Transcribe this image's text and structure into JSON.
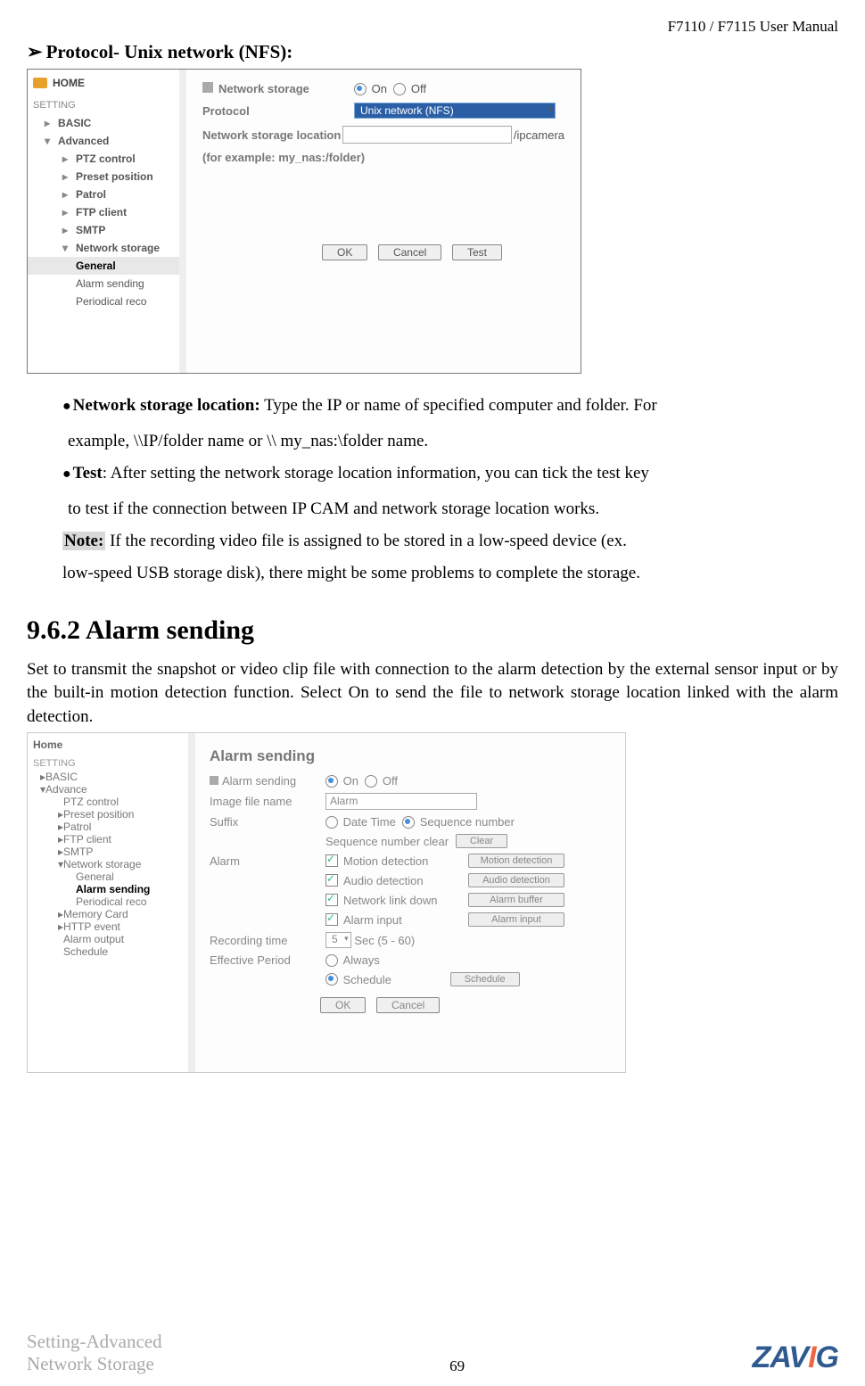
{
  "header_right": "F7110 / F7115 User Manual",
  "section1_title": "Protocol- Unix network (NFS):",
  "arrow_char": "➢",
  "screenshot1": {
    "sidebar": {
      "home": "HOME",
      "setting_label": "SETTING",
      "basic": "BASIC",
      "advanced": "Advanced",
      "items": [
        "PTZ control",
        "Preset position",
        "Patrol",
        "FTP client",
        "SMTP",
        "Network storage"
      ],
      "sub_general": "General",
      "sub_alarm": "Alarm sending",
      "sub_periodical": "Periodical reco"
    },
    "main": {
      "ns_label": "Network storage",
      "on": "On",
      "off": "Off",
      "protocol_label": "Protocol",
      "protocol_value": "Unix network (NFS)",
      "location_label": "Network storage location",
      "location_suffix": "/ipcamera",
      "example": "(for example: my_nas:/folder)",
      "ok": "OK",
      "cancel": "Cancel",
      "test": "Test"
    }
  },
  "body_text": {
    "bullet1_label": "Network storage location:",
    "bullet1_tail_a": " Type the IP or name of specified computer and folder. For",
    "bullet1_tail_b": "example, \\\\IP/folder name or \\\\ my_nas:\\folder name.",
    "bullet2_label": "Test",
    "bullet2_tail_a": ": After setting the network storage location information, you can tick the test key",
    "bullet2_tail_b": "to test if the connection between IP CAM and network storage location works.",
    "note_label": "Note:",
    "note_tail_a": " If the recording video file is assigned to be stored in a low-speed device (ex.",
    "note_tail_b": "low-speed USB storage disk), there might be some problems to complete the storage."
  },
  "section2_heading": "9.6.2 Alarm sending",
  "section2_para": "Set to transmit the snapshot or video clip file with connection to the alarm detection by the external sensor input or by the built-in motion detection function. Select On to send the file to network storage location linked with the alarm detection.",
  "screenshot2": {
    "sidebar": {
      "home": "Home",
      "setting_label": "SETTING",
      "basic": "BASIC",
      "advance": "Advance",
      "items": [
        "PTZ control",
        "Preset position",
        "Patrol",
        "FTP client",
        "SMTP",
        "Network storage"
      ],
      "sub_general": "General",
      "sub_alarm": "Alarm sending",
      "sub_periodical": "Periodical reco",
      "memory": "Memory Card",
      "http_event": "HTTP event",
      "alarm_output": "Alarm output",
      "schedule": "Schedule"
    },
    "main": {
      "title": "Alarm sending",
      "alarm_sending_label": "Alarm sending",
      "on": "On",
      "off": "Off",
      "image_file_label": "Image file name",
      "image_file_value": "Alarm",
      "suffix_label": "Suffix",
      "suffix_date": "Date Time",
      "suffix_seq": "Sequence number",
      "seq_clear_label": "Sequence number clear",
      "clear_btn": "Clear",
      "alarm_label": "Alarm",
      "alarm_chk1": "Motion detection",
      "alarm_btn1": "Motion detection",
      "alarm_chk2": "Audio detection",
      "alarm_btn2": "Audio detection",
      "alarm_chk3": "Network link down",
      "alarm_btn3": "Alarm buffer",
      "alarm_chk4": "Alarm input",
      "alarm_btn4": "Alarm input",
      "rec_time_label": "Recording time",
      "rec_time_value": "5",
      "rec_time_unit": "Sec (5 - 60)",
      "eff_period_label": "Effective Period",
      "eff_always": "Always",
      "eff_schedule": "Schedule",
      "schedule_btn": "Schedule",
      "ok": "OK",
      "cancel": "Cancel"
    }
  },
  "footer": {
    "left_line1": "Setting-Advanced",
    "left_line2": "Network Storage",
    "page_number": "69",
    "logo_text": "ZAV",
    "logo_i": "I",
    "logo_g": "G"
  }
}
